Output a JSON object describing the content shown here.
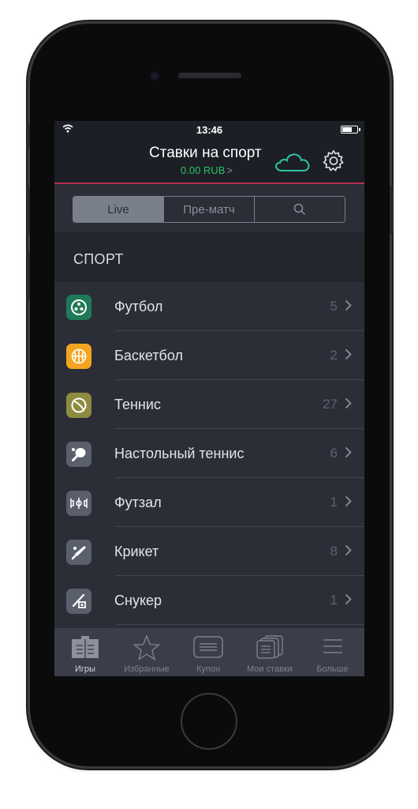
{
  "status_bar": {
    "time": "13:46"
  },
  "header": {
    "title": "Ставки на спорт",
    "balance": "0.00 RUB",
    "balance_chevron": ">"
  },
  "segments": [
    "Live",
    "Пре-матч"
  ],
  "section": {
    "title": "СПОРТ"
  },
  "sports": [
    {
      "label": "Футбол",
      "count": "5",
      "icon": "football-icon",
      "color": "#1f7a57"
    },
    {
      "label": "Баскетбол",
      "count": "2",
      "icon": "basketball-icon",
      "color": "#f4a520"
    },
    {
      "label": "Теннис",
      "count": "27",
      "icon": "tennis-icon",
      "color": "#8d8b3f"
    },
    {
      "label": "Настольный теннис",
      "count": "6",
      "icon": "table-tennis-icon",
      "color": "#5a5f6c"
    },
    {
      "label": "Футзал",
      "count": "1",
      "icon": "futsal-icon",
      "color": "#5a5f6c"
    },
    {
      "label": "Крикет",
      "count": "8",
      "icon": "cricket-icon",
      "color": "#5a5f6c"
    },
    {
      "label": "Снукер",
      "count": "1",
      "icon": "snooker-icon",
      "color": "#5a5f6c"
    }
  ],
  "tabbar": [
    {
      "label": "Игры",
      "icon": "games-icon",
      "active": true
    },
    {
      "label": "Избранные",
      "icon": "star-icon",
      "active": false
    },
    {
      "label": "Купон",
      "icon": "coupon-icon",
      "active": false
    },
    {
      "label": "Мои ставки",
      "icon": "my-bets-icon",
      "active": false
    },
    {
      "label": "Больше",
      "icon": "menu-icon",
      "active": false
    }
  ],
  "colors": {
    "accent_green": "#2dc36a",
    "header_line": "#b53053",
    "background": "#2b2e37"
  }
}
